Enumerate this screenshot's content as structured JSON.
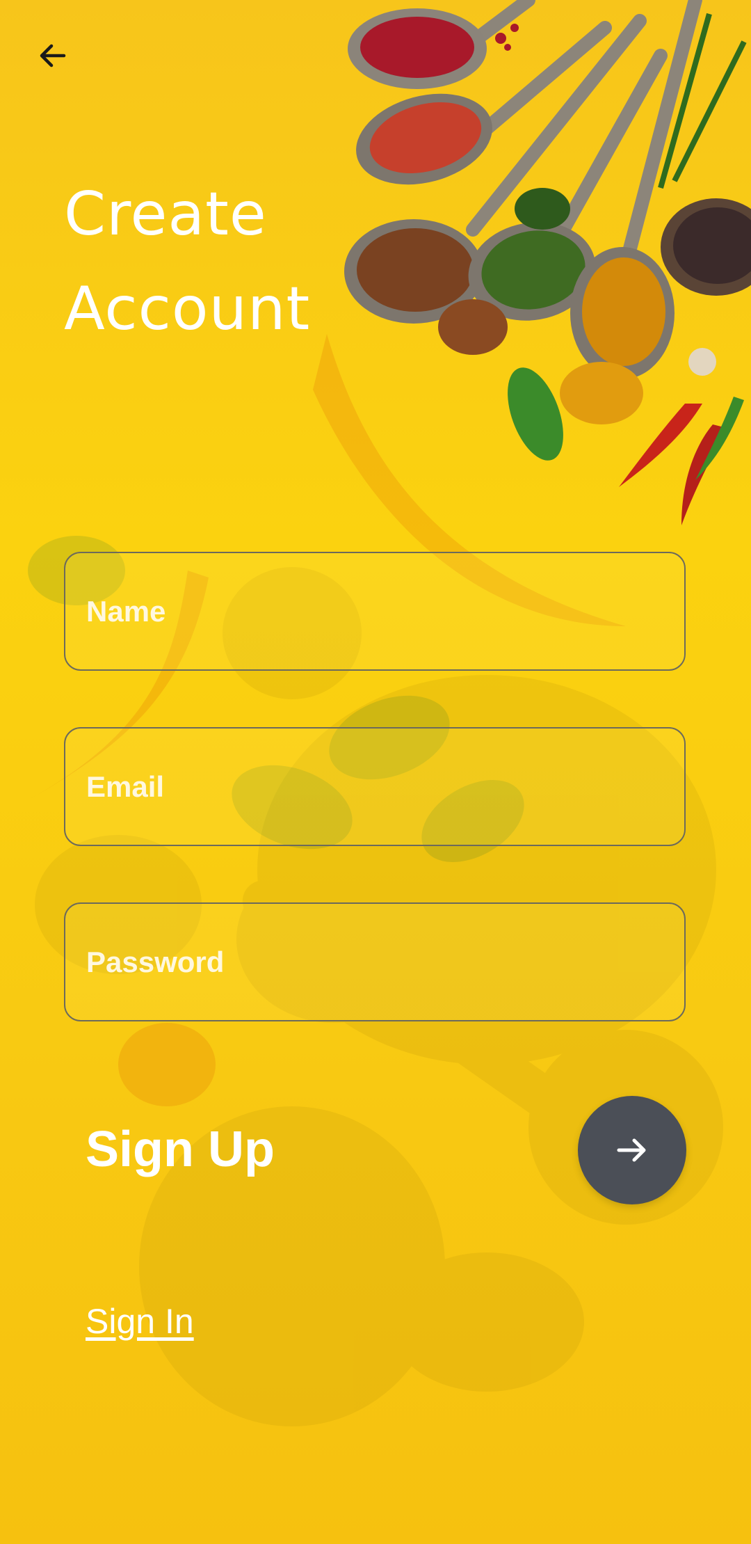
{
  "header": {
    "back_icon": "arrow-left-icon",
    "title": "Create\nAccount"
  },
  "form": {
    "name_placeholder": "Name",
    "email_placeholder": "Email",
    "password_placeholder": "Password",
    "name_value": "",
    "email_value": "",
    "password_value": ""
  },
  "actions": {
    "signup_label": "Sign Up",
    "signup_icon": "arrow-right-icon",
    "signin_label": "Sign In"
  },
  "colors": {
    "background": "#f9cc12",
    "fab": "#4b4f57",
    "text": "#ffffff",
    "field_border": "#6c6a5c"
  }
}
